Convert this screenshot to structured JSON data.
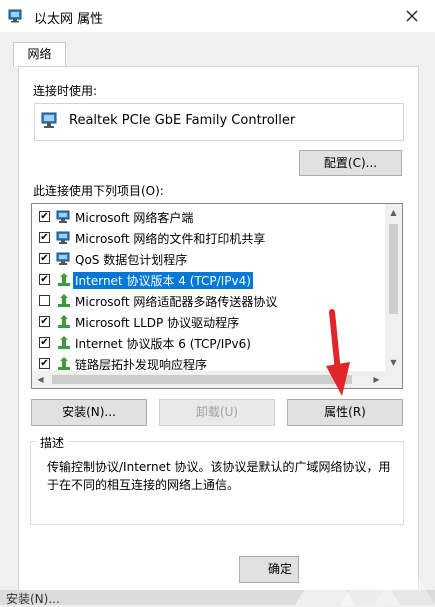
{
  "window": {
    "title": "以太网 属性",
    "close_icon": "close-icon"
  },
  "tab": {
    "label": "网络"
  },
  "connect_using": {
    "label": "连接时使用:",
    "device": "Realtek PCIe GbE Family Controller",
    "configure_button": "配置(C)..."
  },
  "items_label": "此连接使用下列项目(O):",
  "items": [
    {
      "label": "Microsoft 网络客户端",
      "checked": true,
      "icon": "network-client-icon"
    },
    {
      "label": "Microsoft 网络的文件和打印机共享",
      "checked": true,
      "icon": "file-share-icon"
    },
    {
      "label": "QoS 数据包计划程序",
      "checked": true,
      "icon": "qos-icon"
    },
    {
      "label": "Internet 协议版本 4 (TCP/IPv4)",
      "checked": true,
      "icon": "protocol-icon",
      "selected": true
    },
    {
      "label": "Microsoft 网络适配器多路传送器协议",
      "checked": false,
      "icon": "protocol-icon"
    },
    {
      "label": "Microsoft LLDP 协议驱动程序",
      "checked": true,
      "icon": "protocol-icon"
    },
    {
      "label": "Internet 协议版本 6 (TCP/IPv6)",
      "checked": true,
      "icon": "protocol-icon"
    },
    {
      "label": "链路层拓扑发现响应程序",
      "checked": true,
      "icon": "protocol-icon"
    }
  ],
  "buttons": {
    "install": "安装(N)...",
    "uninstall": "卸载(U)",
    "properties": "属性(R)"
  },
  "description": {
    "title": "描述",
    "text": "传输控制协议/Internet 协议。该协议是默认的广域网络协议，用于在不同的相互连接的网络上通信。"
  },
  "footer": {
    "ok_partial": "确定",
    "outside_text": "安装(N)..."
  },
  "colors": {
    "accent": "#0078d7",
    "arrow": "#e0262b"
  }
}
